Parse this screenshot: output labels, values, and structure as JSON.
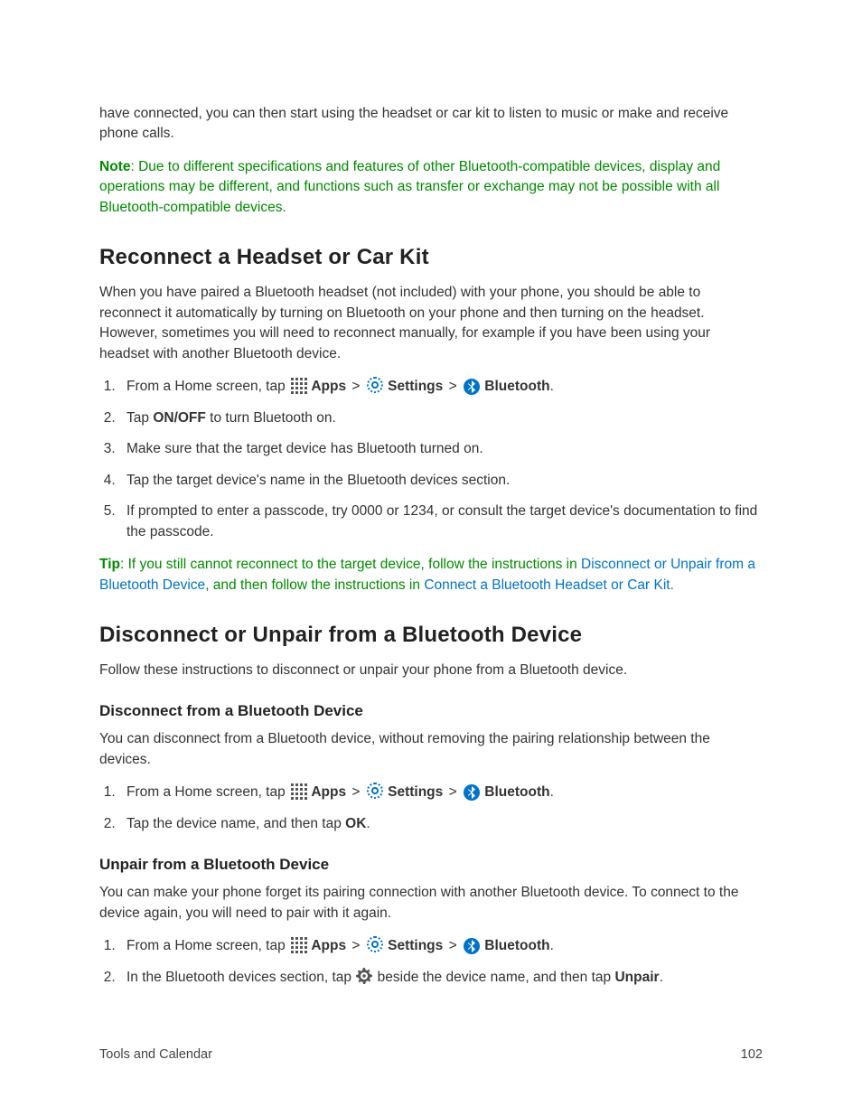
{
  "intro_paragraph": "have connected, you can then start using the headset or car kit to listen to music or make and receive phone calls.",
  "note": {
    "label": "Note",
    "text": ": Due to different specifications and features of other Bluetooth-compatible devices, display and operations may be different, and functions such as transfer or exchange may not be possible with all Bluetooth-compatible devices."
  },
  "section1": {
    "heading": "Reconnect a Headset or Car Kit",
    "intro": "When you have paired a Bluetooth headset (not included) with your phone, you should be able to reconnect it automatically by turning on Bluetooth on your phone and then turning on the headset. However, sometimes you will need to reconnect manually, for example if you have been using your headset with another Bluetooth device.",
    "steps": {
      "s1_pre": "From a Home screen, tap ",
      "apps": "Apps",
      "settings": "Settings",
      "bluetooth": "Bluetooth",
      "s2_pre": "Tap ",
      "s2_bold": "ON/OFF",
      "s2_post": " to turn Bluetooth on.",
      "s3": "Make sure that the target device has Bluetooth turned on.",
      "s4": "Tap the target device's name in the Bluetooth devices section.",
      "s5": "If prompted to enter a passcode, try 0000 or 1234, or consult the target device's documentation to find the passcode."
    },
    "tip": {
      "label": "Tip",
      "pre": ": If you still cannot reconnect to the target device, follow the instructions in ",
      "link1": "Disconnect or Unpair from a Bluetooth Device",
      "mid": ", and then follow the instructions in ",
      "link2": "Connect a Bluetooth Headset or Car Kit",
      "post": "."
    }
  },
  "section2": {
    "heading": "Disconnect or Unpair from a Bluetooth Device",
    "intro": "Follow these instructions to disconnect or unpair your phone from a Bluetooth device.",
    "sub1": {
      "heading": "Disconnect from a Bluetooth Device",
      "intro": "You can disconnect from a Bluetooth device, without removing the pairing relationship between the devices.",
      "s2_pre": "Tap the device name, and then tap ",
      "s2_bold": "OK",
      "s2_post": "."
    },
    "sub2": {
      "heading": "Unpair from a Bluetooth Device",
      "intro": "You can make your phone forget its pairing connection with another Bluetooth device. To connect to the device again, you will need to pair with it again.",
      "s2_pre": "In the Bluetooth devices section, tap ",
      "s2_mid": " beside the device name, and then tap ",
      "s2_bold": "Unpair",
      "s2_post": "."
    }
  },
  "nav": {
    "sep": ">"
  },
  "footer": {
    "left": "Tools and Calendar",
    "right": "102"
  }
}
